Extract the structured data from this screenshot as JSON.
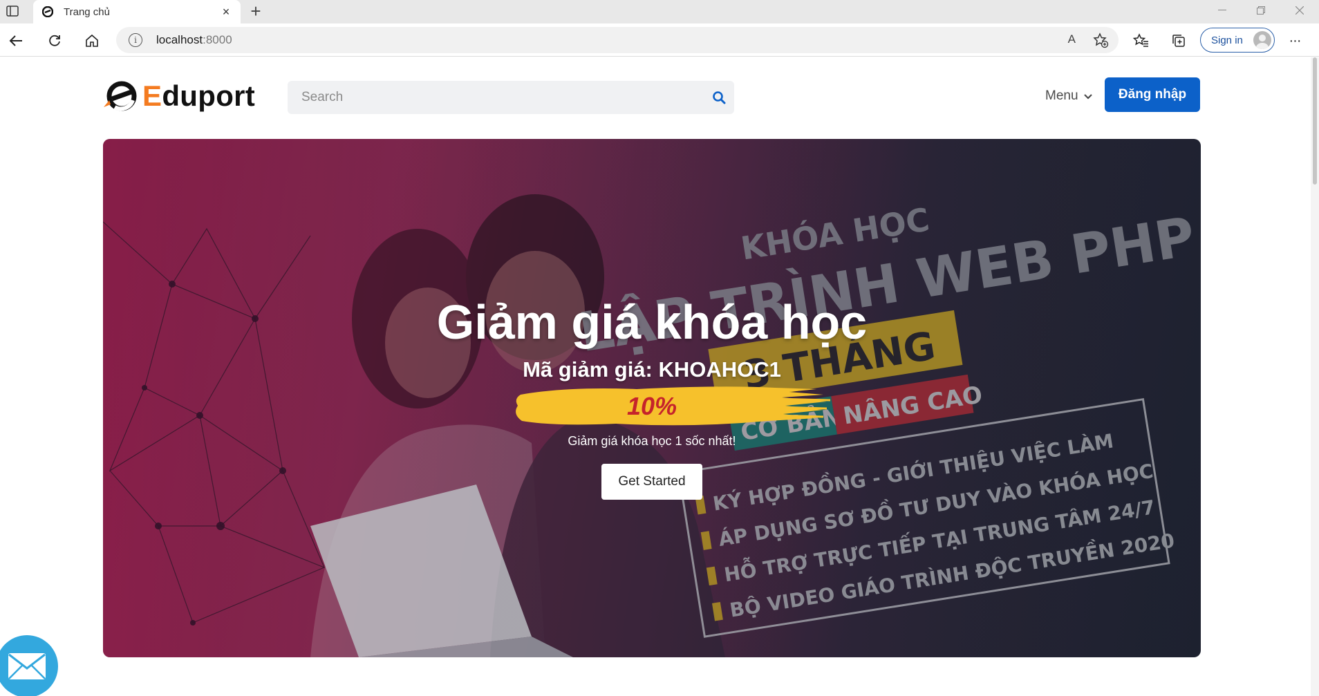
{
  "browser": {
    "tab_title": "Trang chủ",
    "tab_close_glyph": "×",
    "new_tab_glyph": "+",
    "url_host": "localhost",
    "url_port": ":8000",
    "signin_label": "Sign in",
    "info_glyph": "i",
    "read_aloud_glyph": "A",
    "more_glyph": "···"
  },
  "site": {
    "logo_first": "E",
    "logo_rest": "duport",
    "search_placeholder": "Search",
    "menu_label": "Menu",
    "login_label": "Đăng nhập"
  },
  "hero": {
    "title": "Giảm giá khóa học",
    "code_line": "Mã giảm giá: KHOAHOC1",
    "percent": "10%",
    "subtitle": "Giảm giá khóa học 1 sốc nhất!",
    "cta_label": "Get Started"
  },
  "poster": {
    "line1": "KHÓA HỌC",
    "line2": "LẬP TRÌNH WEB PHP",
    "line3": "3 THÁNG",
    "tag_basic": "CƠ BẢN",
    "tag_advanced": "NÂNG CAO",
    "bullets": [
      "KÝ HỢP ĐỒNG - GIỚI THIỆU VIỆC LÀM",
      "ÁP DỤNG SƠ ĐỒ TƯ DUY VÀO KHÓA HỌC",
      "HỖ TRỢ TRỰC TIẾP TẠI TRUNG TÂM 24/7",
      "BỘ VIDEO GIÁO TRÌNH ĐỘC TRUYỀN 2020"
    ]
  },
  "colors": {
    "brand_orange": "#f47b20",
    "primary_blue": "#0c61c9",
    "promo_yellow": "#f6c12c",
    "promo_red": "#c5232b",
    "mail_blue": "#33a8de"
  },
  "icons": {
    "sidebar": "tab-sidebar-icon",
    "back": "back-arrow-icon",
    "reload": "reload-icon",
    "home": "home-icon",
    "favorite_add": "star-plus-icon",
    "favorites": "favorites-icon",
    "collections": "collections-icon",
    "search": "magnifier-icon",
    "mail": "envelope-icon"
  }
}
